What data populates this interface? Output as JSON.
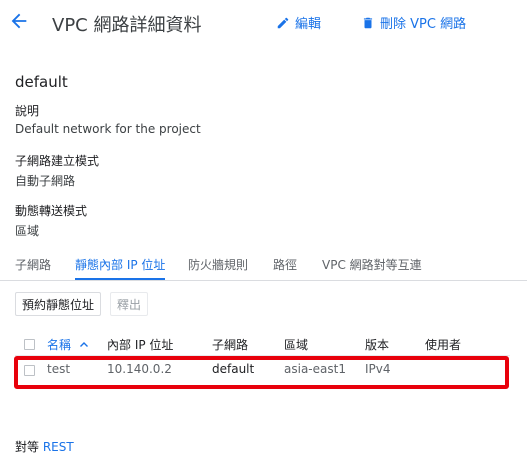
{
  "header": {
    "title": "VPC 網路詳細資料",
    "edit_label": "編輯",
    "delete_label": "刪除 VPC 網路"
  },
  "network": {
    "name": "default",
    "description_label": "說明",
    "description_value": "Default network for the project",
    "subnet_mode_label": "子網路建立模式",
    "subnet_mode_value": "自動子網路",
    "routing_mode_label": "動態轉送模式",
    "routing_mode_value": "區域"
  },
  "tabs": [
    {
      "label": "子網路"
    },
    {
      "label": "靜態內部 IP 位址"
    },
    {
      "label": "防火牆規則"
    },
    {
      "label": "路徑"
    },
    {
      "label": "VPC 網路對等互連"
    }
  ],
  "buttons": {
    "reserve_label": "預約靜態位址",
    "release_label": "釋出"
  },
  "table": {
    "columns": [
      "名稱",
      "內部 IP 位址",
      "子網路",
      "區域",
      "版本",
      "使用者"
    ],
    "rows": [
      {
        "name": "test",
        "ip": "10.140.0.2",
        "subnet": "default",
        "region": "asia-east1",
        "version": "IPv4",
        "user": ""
      }
    ]
  },
  "footer": {
    "prefix": "對等",
    "link": "REST"
  },
  "colors": {
    "accent": "#1a73e8",
    "highlight": "#e8000b"
  }
}
